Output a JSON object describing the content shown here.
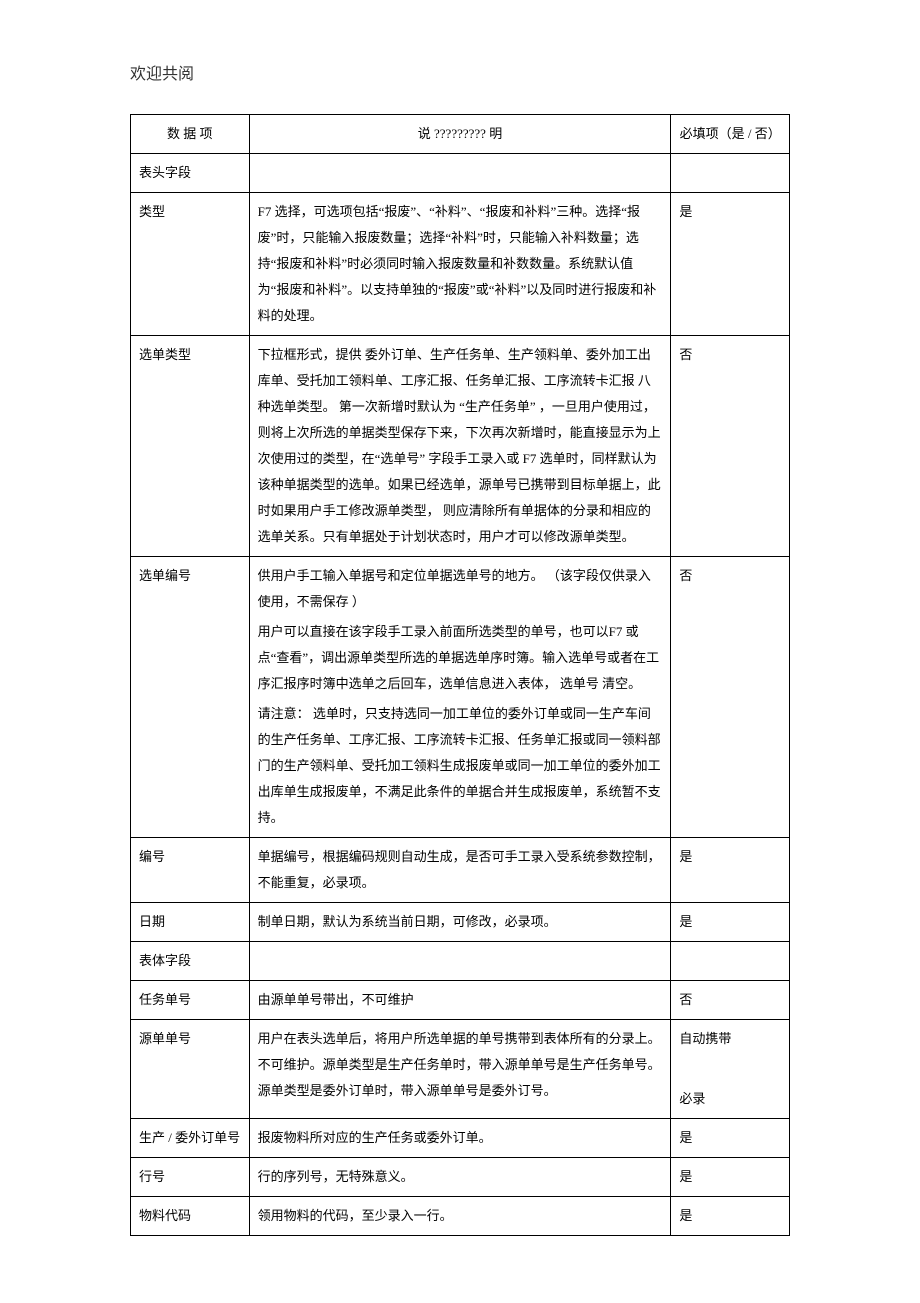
{
  "page_header": "欢迎共阅",
  "columns": {
    "c1": "数 据 项",
    "c2": "说 ????????? 明",
    "c3": "必填项（是 / 否）"
  },
  "sections": {
    "header_fields": "表头字段",
    "body_fields": "表体字段"
  },
  "rows": {
    "type": {
      "label": "类型",
      "desc": "F7 选择，可选项包括“报废”、“补料”、“报废和补料”三种。选择“报废”时，只能输入报废数量；选择“补料”时，只能输入补料数量；选持“报废和补料”时必须同时输入报废数量和补数数量。系统默认值为“报废和补料”。以支持单独的“报废”或“补料”以及同时进行报废和补料的处理。",
      "req": "是"
    },
    "pick_type": {
      "label": "选单类型",
      "desc": "下拉框形式，提供 委外订单、生产任务单、生产领料单、委外加工出库单、受托加工领料单、工序汇报、任务单汇报、工序流转卡汇报 八种选单类型。 第一次新增时默认为 “生产任务单” ，一旦用户使用过，则将上次所选的单据类型保存下来，下次再次新增时，能直接显示为上次使用过的类型，在“选单号”        字段手工录入或 F7 选单时，同样默认为该种单据类型的选单。如果已经选单，源单号已携带到目标单据上，此时如果用户手工修改源单类型， 则应清除所有单据体的分录和相应的选单关系。只有单据处于计划状态时，用户才可以修改源单类型。",
      "req": "否"
    },
    "pick_no": {
      "label": "选单编号",
      "desc_p1": "供用户手工输入单据号和定位单据选单号的地方。    （该字段仅供录入使用，不需保存 ）",
      "desc_p2": "用户可以直接在该字段手工录入前面所选类型的单号，也可以F7 或点“查看”，调出源单类型所选的单据选单序时簿。输入选单号或者在工序汇报序时簿中选单之后回车，选单信息进入表体，  选单号  清空。",
      "desc_p3": "请注意： 选单时，只支持选同一加工单位的委外订单或同一生产车间的生产任务单、工序汇报、工序流转卡汇报、任务单汇报或同一领料部门的生产领料单、受托加工领料生成报废单或同一加工单位的委外加工出库单生成报废单，不满足此条件的单据合并生成报废单，系统暂不支持。",
      "req": "否"
    },
    "doc_no": {
      "label": "编号",
      "desc": "单据编号，根据编码规则自动生成，是否可手工录入受系统参数控制，不能重复，必录项。",
      "req": "是"
    },
    "date": {
      "label": "日期",
      "desc": "制单日期，默认为系统当前日期，可修改，必录项。",
      "req": "是"
    },
    "task_no": {
      "label": "任务单号",
      "desc": "由源单单号带出，不可维护",
      "req": "否"
    },
    "src_no": {
      "label": "源单单号",
      "desc": "用户在表头选单后，将用户所选单据的单号携带到表体所有的分录上。不可维护。源单类型是生产任务单时，带入源单单号是生产任务单号。源单类型是委外订单时，带入源单单号是委外订号。",
      "req_p1": "自动携带",
      "req_p2": "必录"
    },
    "order_no": {
      "label": "生产 / 委外订单号",
      "desc": "报废物料所对应的生产任务或委外订单。",
      "req": "是"
    },
    "line_no": {
      "label": "行号",
      "desc": "行的序列号，无特殊意义。",
      "req": "是"
    },
    "mat_code": {
      "label": "物料代码",
      "desc": "领用物料的代码，至少录入一行。",
      "req": "是"
    }
  }
}
